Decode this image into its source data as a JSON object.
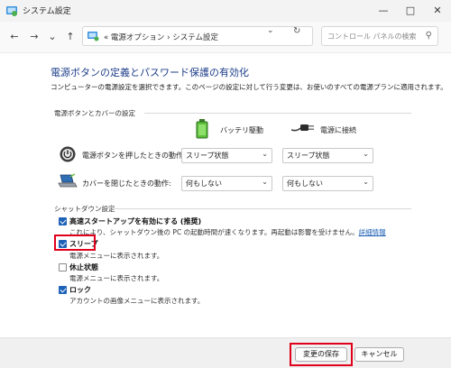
{
  "window": {
    "title": "システム設定"
  },
  "address": {
    "prefix": "«",
    "crumb1": "電源オプション",
    "sep": "›",
    "crumb2": "システム設定"
  },
  "search": {
    "placeholder": "コントロール パネルの検索"
  },
  "main": {
    "heading": "電源ボタンの定義とパスワード保護の有効化",
    "description": "コンピューターの電源設定を選択できます。このページの設定に対して行う変更は、お使いのすべての電源プランに適用されます。"
  },
  "power_section": {
    "label": "電源ボタンとカバーの設定",
    "col_battery": "バッテリ駆動",
    "col_plugged": "電源に接続",
    "rows": [
      {
        "label": "電源ボタンを押したときの動作:",
        "battery": "スリープ状態",
        "plugged": "スリープ状態"
      },
      {
        "label": "カバーを閉じたときの動作:",
        "battery": "何もしない",
        "plugged": "何もしない"
      }
    ]
  },
  "shutdown_section": {
    "label": "シャットダウン設定",
    "items": [
      {
        "label": "高速スタートアップを有効にする (推奨)",
        "checked": true,
        "desc": "これにより、シャットダウン後の PC の起動時間が速くなります。再起動は影響を受けません。",
        "link": "詳細情報"
      },
      {
        "label": "スリープ",
        "checked": true,
        "desc": "電源メニューに表示されます。"
      },
      {
        "label": "休止状態",
        "checked": false,
        "desc": "電源メニューに表示されます。"
      },
      {
        "label": "ロック",
        "checked": true,
        "desc": "アカウントの画像メニューに表示されます。"
      }
    ]
  },
  "footer": {
    "save_label": "変更の保存",
    "cancel_label": "キャンセル"
  },
  "colors": {
    "accent": "#1f63b8",
    "heading": "#1e3f8a",
    "highlight": "#e0001b"
  }
}
